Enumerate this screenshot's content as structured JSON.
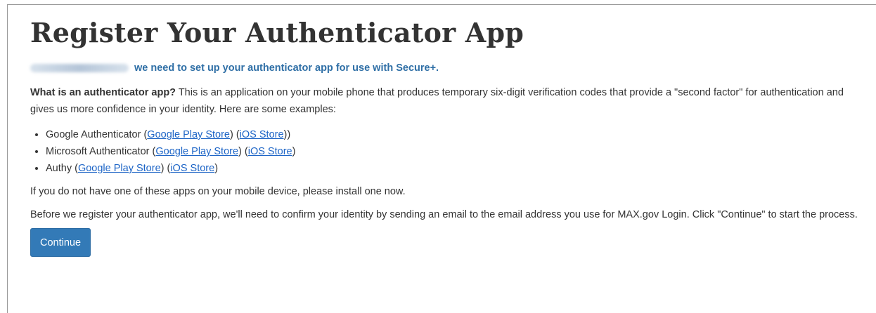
{
  "page": {
    "title": "Register Your Authenticator App",
    "subtitle_rest": "we need to set up your authenticator app for use with Secure+.",
    "intro_bold": "What is an authenticator app?",
    "intro_text": " This is an application on your mobile phone that produces temporary six-digit verification codes that provide a \"second factor\" for authentication and gives us more confidence in your identity. Here are some examples:",
    "apps": [
      {
        "name": "Google Authenticator",
        "play_label": "Google Play Store",
        "ios_label": "iOS Store",
        "suffix": "))"
      },
      {
        "name": "Microsoft Authenticator",
        "play_label": "Google Play Store",
        "ios_label": "iOS Store",
        "suffix": ")"
      },
      {
        "name": "Authy",
        "play_label": "Google Play Store",
        "ios_label": "iOS Store",
        "suffix": ")"
      }
    ],
    "install_text": "If you do not have one of these apps on your mobile device, please install one now.",
    "confirm_text": "Before we register your authenticator app, we'll need to confirm your identity by sending an email to the email address you use for MAX.gov Login. Click \"Continue\" to start the process.",
    "continue_label": "Continue"
  },
  "colors": {
    "link": "#1c64c6",
    "subtitle": "#2f6fa6",
    "button": "#337ab7",
    "text": "#333333"
  }
}
